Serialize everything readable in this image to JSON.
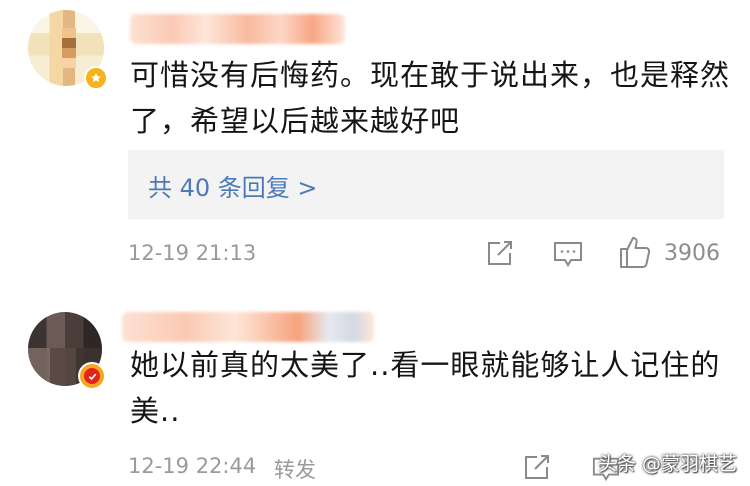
{
  "comments": [
    {
      "text": "可惜没有后悔药。现在敢于说出来，也是释然了，希望以后越来越好吧",
      "replies_link": "共 40 条回复 >",
      "timestamp": "12-19 21:13",
      "like_count": "3906",
      "icons": [
        "share-icon",
        "comment-icon",
        "like-icon"
      ]
    },
    {
      "text": "她以前真的太美了..看一眼就能够让人记住的美..",
      "timestamp": "12-19 22:44",
      "forward_label": "转发",
      "icons": [
        "share-icon",
        "comment-icon"
      ]
    }
  ],
  "watermark": "头条 @蒙羽棋艺",
  "colors": {
    "link": "#4d7ab7",
    "meta": "#9a9a9a",
    "badge_gold": "#f6b31a",
    "badge_red": "#e4231b"
  }
}
